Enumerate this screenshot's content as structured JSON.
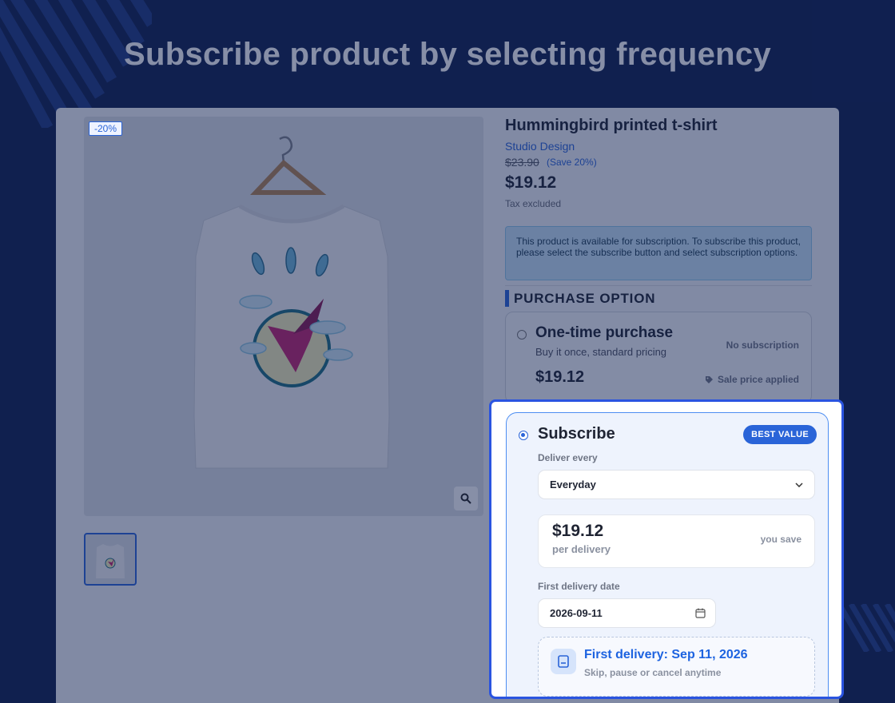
{
  "headline": "Subscribe product by selecting frequency",
  "product": {
    "discount_badge": "-20%",
    "title": "Hummingbird printed t-shirt",
    "brand": "Studio Design",
    "old_price": "$23.90",
    "save_text": "(Save 20%)",
    "price": "$19.12",
    "tax_note": "Tax excluded"
  },
  "alert_text": "This product is available for subscription. To subscribe this product, please select the subscribe button and select subscription options.",
  "purchase_section": {
    "title": "PURCHASE OPTION",
    "one_time": {
      "title": "One-time purchase",
      "subtitle": "Buy it once, standard pricing",
      "tag": "No subscription",
      "price": "$19.12",
      "sale_note": "Sale price applied"
    },
    "subscribe": {
      "title": "Subscribe",
      "badge": "BEST VALUE",
      "deliver_label": "Deliver every",
      "frequency": "Everyday",
      "price": "$19.12",
      "per_delivery": "per delivery",
      "you_save": "you save",
      "first_date_label": "First delivery date",
      "first_date_value": "2026-09-11",
      "first_delivery_title": "First delivery: Sep 11, 2026",
      "first_delivery_sub": "Skip, pause or cancel anytime"
    }
  },
  "colors": {
    "background": "#11204f",
    "accent": "#2a64d8",
    "focus_border": "#2a54e0"
  }
}
